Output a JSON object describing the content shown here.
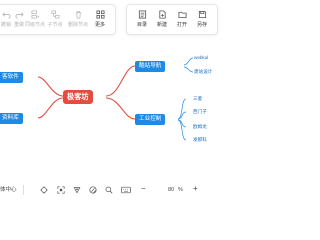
{
  "toolbar": {
    "left_group": [
      {
        "label": "撤销",
        "icon": "undo-icon",
        "enabled": false
      },
      {
        "label": "重做",
        "icon": "redo-icon",
        "enabled": false
      },
      {
        "label": "同级节点",
        "icon": "sibling-node-icon",
        "enabled": false
      },
      {
        "label": "子节点",
        "icon": "child-node-icon",
        "enabled": false
      },
      {
        "label": "删除节点",
        "icon": "delete-node-icon",
        "enabled": false
      },
      {
        "label": "更多",
        "icon": "more-icon",
        "enabled": true
      }
    ],
    "right_group": [
      {
        "label": "目录",
        "icon": "directory-icon"
      },
      {
        "label": "新建",
        "icon": "new-file-icon"
      },
      {
        "label": "打开",
        "icon": "open-file-icon"
      },
      {
        "label": "另存",
        "icon": "save-as-icon"
      }
    ]
  },
  "mindmap": {
    "root": "极客坊",
    "left_nodes": [
      "客软件",
      "资料库"
    ],
    "right_nodes": [
      {
        "label": "酷站导航",
        "children": [
          "webkul",
          "建站设计"
        ]
      },
      {
        "label": "工业控制",
        "children": [
          "三菱",
          "西门子",
          "欧姆龙",
          "发那科"
        ]
      }
    ]
  },
  "bottom_bar": {
    "view_label": "体中心",
    "zoom": "80",
    "zoom_unit": "%",
    "zoom_out_label": "−",
    "zoom_in_label": "+"
  },
  "colors": {
    "root": "#e34d3f",
    "branch": "#1f8ae6",
    "leaf_text": "#1f6fbf",
    "toolbar_border": "#e6e6e6"
  }
}
